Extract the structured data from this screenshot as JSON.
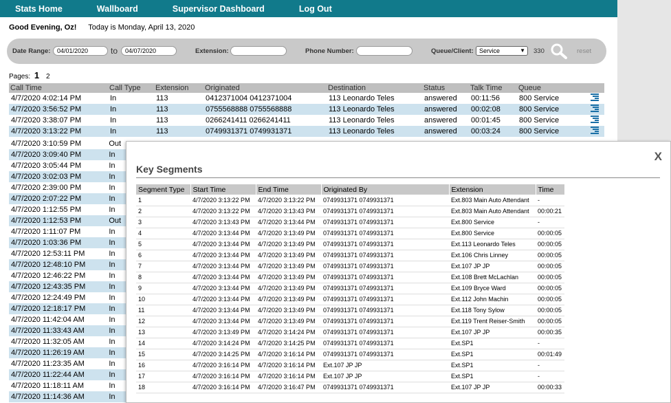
{
  "nav": {
    "items": [
      "Stats Home",
      "Wallboard",
      "Supervisor Dashboard",
      "Log Out"
    ]
  },
  "greeting": {
    "hello": "Good Evening, Oz!",
    "today": "Today is Monday, April 13, 2020"
  },
  "search": {
    "date_range_label": "Date Range:",
    "date_from": "04/01/2020",
    "to_label": "to",
    "date_to": "04/07/2020",
    "extension_label": "Extension:",
    "extension_value": "",
    "phone_label": "Phone Number:",
    "phone_value": "",
    "queue_label": "Queue/Client:",
    "queue_selected": "Service",
    "queue_count": "330",
    "reset_label": "reset",
    "search_icon": "magnifier-icon"
  },
  "pages": {
    "label": "Pages:",
    "current": "1",
    "other": "2"
  },
  "calls": {
    "headers": [
      "Call Time",
      "Call Type",
      "Extension",
      "Originated",
      "Destination",
      "Status",
      "Talk Time",
      "Queue"
    ],
    "rows": [
      [
        "4/7/2020 4:02:14 PM",
        "In",
        "113",
        "0412371004 0412371004",
        "113 Leonardo Teles",
        "answered",
        "00:11:56",
        "800 Service"
      ],
      [
        "4/7/2020 3:56:52 PM",
        "In",
        "113",
        "0755568888 0755568888",
        "113 Leonardo Teles",
        "answered",
        "00:02:08",
        "800 Service"
      ],
      [
        "4/7/2020 3:38:07 PM",
        "In",
        "113",
        "0266241411 0266241411",
        "113 Leonardo Teles",
        "answered",
        "00:01:45",
        "800 Service"
      ],
      [
        "4/7/2020 3:13:22 PM",
        "In",
        "113",
        "0749931371 0749931371",
        "113 Leonardo Teles",
        "answered",
        "00:03:24",
        "800 Service"
      ]
    ],
    "more_rows": [
      [
        "4/7/2020 3:10:59 PM",
        "Out"
      ],
      [
        "4/7/2020 3:09:40 PM",
        "In"
      ],
      [
        "4/7/2020 3:05:44 PM",
        "In"
      ],
      [
        "4/7/2020 3:02:03 PM",
        "In"
      ],
      [
        "4/7/2020 2:39:00 PM",
        "In"
      ],
      [
        "4/7/2020 2:07:22 PM",
        "In"
      ],
      [
        "4/7/2020 1:12:55 PM",
        "In"
      ],
      [
        "4/7/2020 1:12:53 PM",
        "Out"
      ],
      [
        "4/7/2020 1:11:07 PM",
        "In"
      ],
      [
        "4/7/2020 1:03:36 PM",
        "In"
      ],
      [
        "4/7/2020 12:53:11 PM",
        "In"
      ],
      [
        "4/7/2020 12:48:10 PM",
        "In"
      ],
      [
        "4/7/2020 12:46:22 PM",
        "In"
      ],
      [
        "4/7/2020 12:43:35 PM",
        "In"
      ],
      [
        "4/7/2020 12:24:49 PM",
        "In"
      ],
      [
        "4/7/2020 12:18:17 PM",
        "In"
      ],
      [
        "4/7/2020 11:42:04 AM",
        "In"
      ],
      [
        "4/7/2020 11:33:43 AM",
        "In"
      ],
      [
        "4/7/2020 11:32:05 AM",
        "In"
      ],
      [
        "4/7/2020 11:26:19 AM",
        "In"
      ],
      [
        "4/7/2020 11:23:35 AM",
        "In"
      ],
      [
        "4/7/2020 11:22:44 AM",
        "In"
      ],
      [
        "4/7/2020 11:18:11 AM",
        "In"
      ],
      [
        "4/7/2020 11:14:36 AM",
        "In"
      ]
    ]
  },
  "popup": {
    "title": "Key Segments",
    "close_label": "X",
    "headers": [
      "Segment Type",
      "Start Time",
      "End Time",
      "Originated By",
      "Extension",
      "Time"
    ],
    "rows": [
      [
        "1",
        "4/7/2020 3:13:22 PM",
        "4/7/2020 3:13:22 PM",
        "0749931371 0749931371",
        "Ext.803 Main Auto Attendant",
        "-"
      ],
      [
        "2",
        "4/7/2020 3:13:22 PM",
        "4/7/2020 3:13:43 PM",
        "0749931371 0749931371",
        "Ext.803 Main Auto Attendant",
        "00:00:21"
      ],
      [
        "3",
        "4/7/2020 3:13:43 PM",
        "4/7/2020 3:13:44 PM",
        "0749931371 0749931371",
        "Ext.800 Service",
        "-"
      ],
      [
        "4",
        "4/7/2020 3:13:44 PM",
        "4/7/2020 3:13:49 PM",
        "0749931371 0749931371",
        "Ext.800 Service",
        "00:00:05"
      ],
      [
        "5",
        "4/7/2020 3:13:44 PM",
        "4/7/2020 3:13:49 PM",
        "0749931371 0749931371",
        "Ext.113 Leonardo Teles",
        "00:00:05"
      ],
      [
        "6",
        "4/7/2020 3:13:44 PM",
        "4/7/2020 3:13:49 PM",
        "0749931371 0749931371",
        "Ext.106 Chris Linney",
        "00:00:05"
      ],
      [
        "7",
        "4/7/2020 3:13:44 PM",
        "4/7/2020 3:13:49 PM",
        "0749931371 0749931371",
        "Ext.107 JP JP",
        "00:00:05"
      ],
      [
        "8",
        "4/7/2020 3:13:44 PM",
        "4/7/2020 3:13:49 PM",
        "0749931371 0749931371",
        "Ext.108 Brett McLachlan",
        "00:00:05"
      ],
      [
        "9",
        "4/7/2020 3:13:44 PM",
        "4/7/2020 3:13:49 PM",
        "0749931371 0749931371",
        "Ext.109 Bryce Ward",
        "00:00:05"
      ],
      [
        "10",
        "4/7/2020 3:13:44 PM",
        "4/7/2020 3:13:49 PM",
        "0749931371 0749931371",
        "Ext.112 John Machin",
        "00:00:05"
      ],
      [
        "11",
        "4/7/2020 3:13:44 PM",
        "4/7/2020 3:13:49 PM",
        "0749931371 0749931371",
        "Ext.118 Tony Sylow",
        "00:00:05"
      ],
      [
        "12",
        "4/7/2020 3:13:44 PM",
        "4/7/2020 3:13:49 PM",
        "0749931371 0749931371",
        "Ext.119 Trent Reiser-Smith",
        "00:00:05"
      ],
      [
        "13",
        "4/7/2020 3:13:49 PM",
        "4/7/2020 3:14:24 PM",
        "0749931371 0749931371",
        "Ext.107 JP JP",
        "00:00:35"
      ],
      [
        "14",
        "4/7/2020 3:14:24 PM",
        "4/7/2020 3:14:25 PM",
        "0749931371 0749931371",
        "Ext.SP1",
        "-"
      ],
      [
        "15",
        "4/7/2020 3:14:25 PM",
        "4/7/2020 3:16:14 PM",
        "0749931371 0749931371",
        "Ext.SP1",
        "00:01:49"
      ],
      [
        "16",
        "4/7/2020 3:16:14 PM",
        "4/7/2020 3:16:14 PM",
        "Ext.107 JP JP",
        "Ext.SP1",
        "-"
      ],
      [
        "17",
        "4/7/2020 3:16:14 PM",
        "4/7/2020 3:16:14 PM",
        "Ext.107 JP JP",
        "Ext.SP1",
        "-"
      ],
      [
        "18",
        "4/7/2020 3:16:14 PM",
        "4/7/2020 3:16:47 PM",
        "0749931371 0749931371",
        "Ext.107 JP JP",
        "00:00:33"
      ]
    ]
  },
  "colors": {
    "nav_bg": "#117a8b",
    "row_alt": "#cde2ee",
    "icon_blue": "#1a6fa6"
  }
}
